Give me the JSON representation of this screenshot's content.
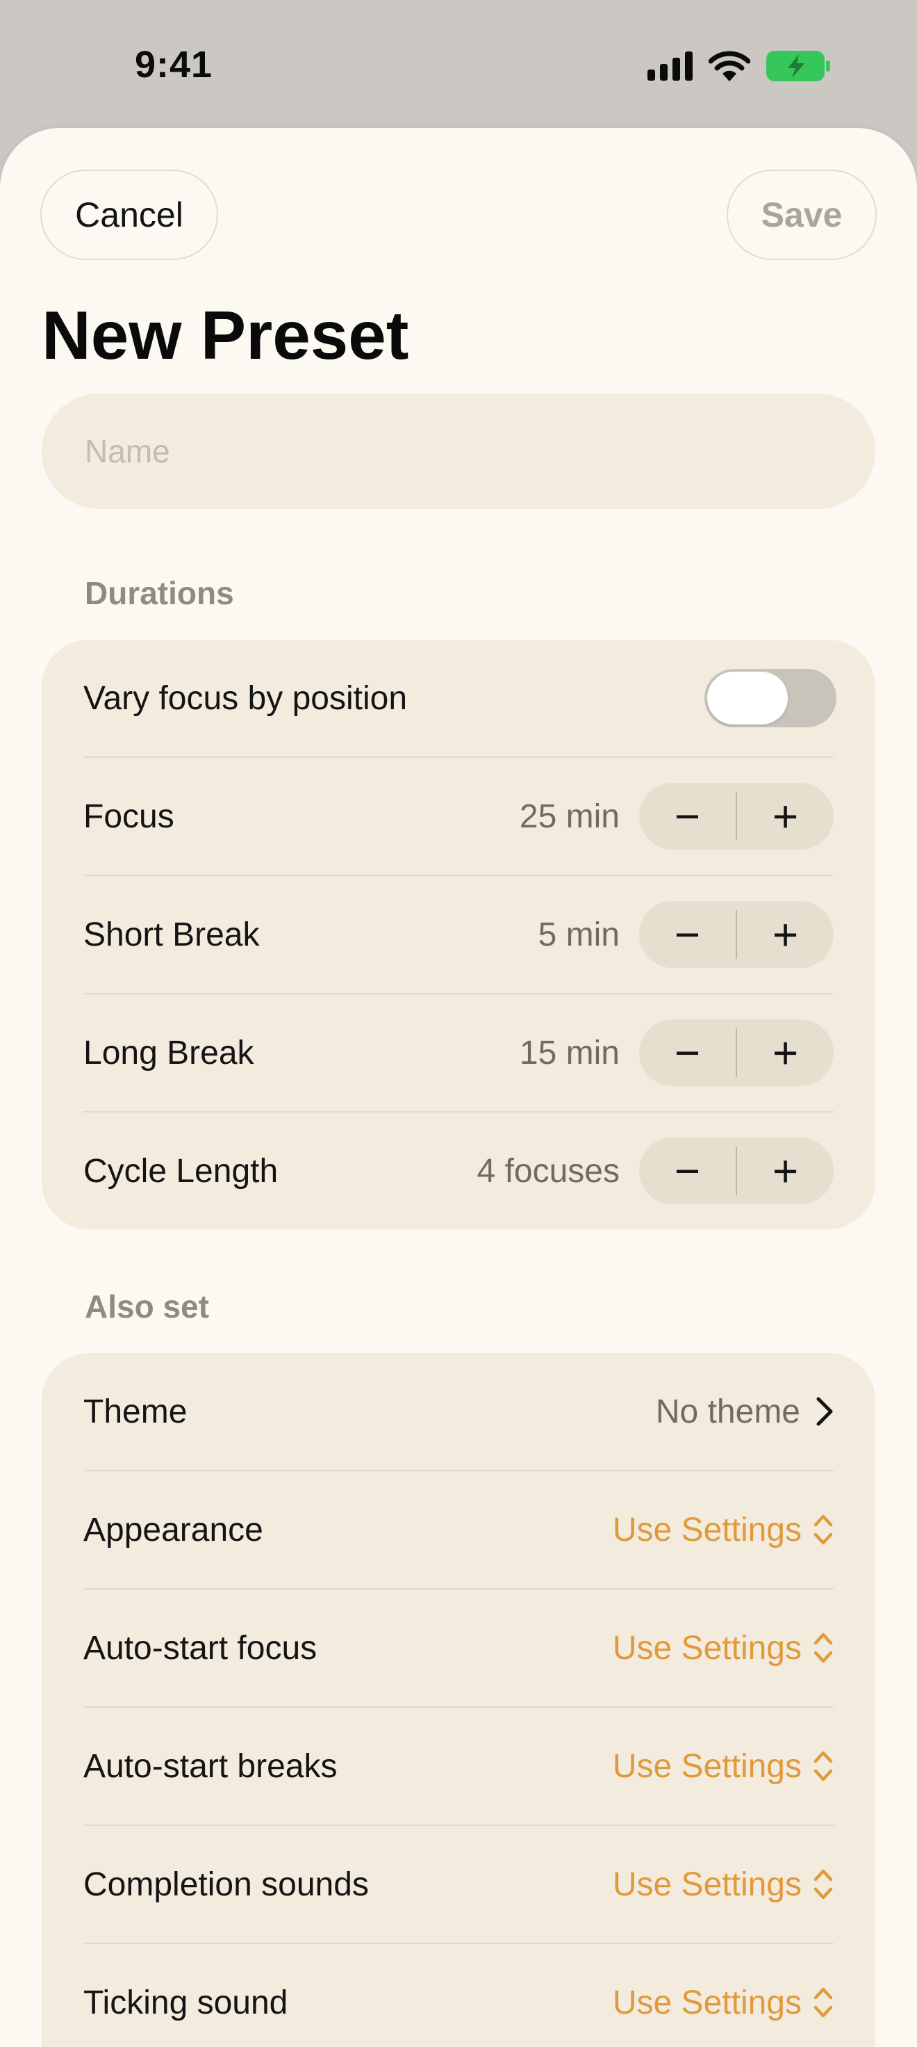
{
  "status_bar": {
    "time": "9:41"
  },
  "header": {
    "cancel_label": "Cancel",
    "save_label": "Save",
    "title": "New Preset"
  },
  "name_field": {
    "placeholder": "Name",
    "value": ""
  },
  "durations": {
    "header": "Durations",
    "vary_focus": {
      "label": "Vary focus by position",
      "on": false
    },
    "rows": [
      {
        "label": "Focus",
        "value": "25 min"
      },
      {
        "label": "Short Break",
        "value": "5 min"
      },
      {
        "label": "Long Break",
        "value": "15 min"
      },
      {
        "label": "Cycle Length",
        "value": "4 focuses"
      }
    ],
    "minus_symbol": "−",
    "plus_symbol": "+"
  },
  "also_set": {
    "header": "Also set",
    "theme": {
      "label": "Theme",
      "value": "No theme"
    },
    "rows": [
      {
        "label": "Appearance",
        "value": "Use Settings"
      },
      {
        "label": "Auto-start focus",
        "value": "Use Settings"
      },
      {
        "label": "Auto-start breaks",
        "value": "Use Settings"
      },
      {
        "label": "Completion sounds",
        "value": "Use Settings"
      },
      {
        "label": "Ticking sound",
        "value": "Use Settings"
      }
    ]
  },
  "colors": {
    "accent": "#e09a3b",
    "sheet_background": "#fcf9f3",
    "card_background": "#f3ebdd",
    "battery_green": "#35c759"
  }
}
